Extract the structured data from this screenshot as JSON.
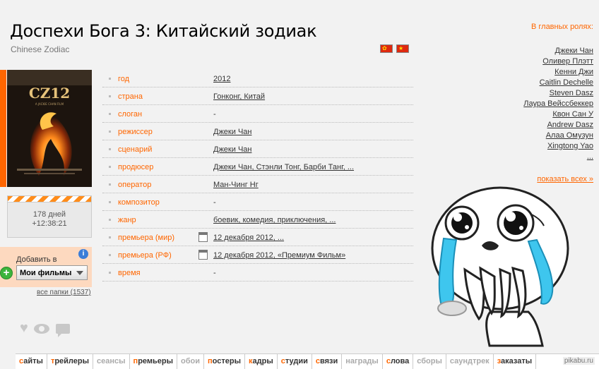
{
  "title": "Доспехи Бога 3: Китайский зодиак",
  "original_title": "Chinese Zodiac",
  "poster": {
    "text": "CZ12",
    "sub": "A JACKIE CHAN FILM"
  },
  "countdown": {
    "days": "178 дней",
    "time": "+12:38:21"
  },
  "add_folder": {
    "label": "Добавить в",
    "selected": "Мои фильмы",
    "all_folders": "все папки (1537)",
    "info": "i",
    "plus": "+"
  },
  "info_rows": [
    {
      "label": "год",
      "value": "2012"
    },
    {
      "label": "страна",
      "value": "Гонконг, Китай"
    },
    {
      "label": "слоган",
      "value": "-"
    },
    {
      "label": "режиссер",
      "value": "Джеки Чан"
    },
    {
      "label": "сценарий",
      "value": "Джеки Чан"
    },
    {
      "label": "продюсер",
      "value": "Джеки Чан, Стэнли Тонг, Барби Танг, ..."
    },
    {
      "label": "оператор",
      "value": "Ман-Чинг Нг"
    },
    {
      "label": "композитор",
      "value": "-"
    },
    {
      "label": "жанр",
      "value": "боевик, комедия, приключения, ..."
    },
    {
      "label": "премьера (мир)",
      "value": "12 декабря 2012, ..."
    },
    {
      "label": "премьера (РФ)",
      "value": "12 декабря 2012, «Премиум Фильм»"
    },
    {
      "label": "время",
      "value": "-"
    }
  ],
  "cast": {
    "header": "В главных ролях:",
    "actors": [
      "Джеки Чан",
      "Оливер Плэтт",
      "Кенни Джи",
      "Caitlin Dechelle",
      "Steven Dasz",
      "Лаура Вейссбеккер",
      "Квон Сан У",
      "Andrew Dasz",
      "Алаа Омузун",
      "Xingtong Yao",
      "..."
    ],
    "show_all": "показать всех »"
  },
  "bottom_nav": [
    {
      "first": "с",
      "rest": "айты",
      "dim": false
    },
    {
      "first": "т",
      "rest": "рейлеры",
      "dim": false
    },
    {
      "first": "",
      "rest": "сеансы",
      "dim": true
    },
    {
      "first": "п",
      "rest": "ремьеры",
      "dim": false
    },
    {
      "first": "",
      "rest": "обои",
      "dim": true
    },
    {
      "first": "п",
      "rest": "остеры",
      "dim": false
    },
    {
      "first": "к",
      "rest": "адры",
      "dim": false
    },
    {
      "first": "с",
      "rest": "тудии",
      "dim": false
    },
    {
      "first": "с",
      "rest": "вязи",
      "dim": false
    },
    {
      "first": "",
      "rest": "награды",
      "dim": true
    },
    {
      "first": "с",
      "rest": "лова",
      "dim": false
    },
    {
      "first": "",
      "rest": "сборы",
      "dim": true
    },
    {
      "first": "",
      "rest": "саундтрек",
      "dim": true
    },
    {
      "first": "з",
      "rest": "аказаты",
      "dim": false
    }
  ],
  "watermark": "pikabu.ru",
  "colors": {
    "accent": "#ff6600",
    "background": "#f2f2f2",
    "tear": "#3ec6ee"
  },
  "icons": [
    "heart-icon",
    "eye-icon",
    "comment-icon",
    "calendar-icon",
    "info-icon",
    "plus-icon",
    "chevron-down-icon",
    "flag-hk-icon",
    "flag-cn-icon"
  ]
}
